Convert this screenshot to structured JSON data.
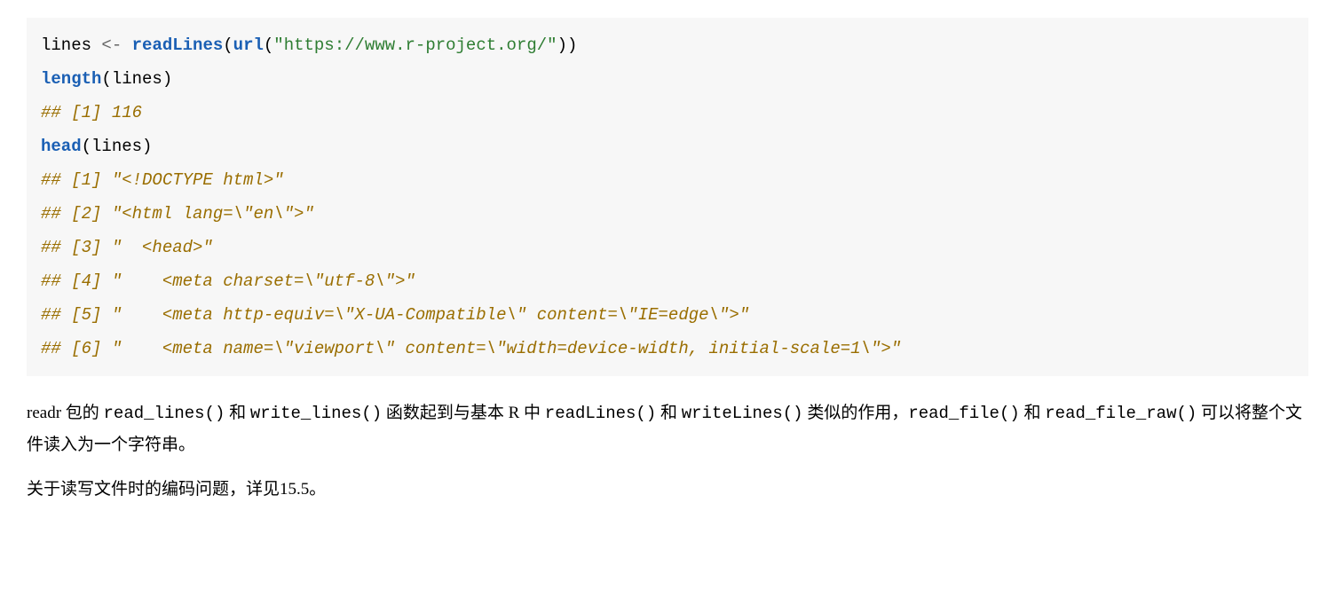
{
  "code_block": {
    "line1_var": "lines ",
    "line1_assign": "<- ",
    "line1_func1": "readLines",
    "line1_paren1": "(",
    "line1_func2": "url",
    "line1_paren2": "(",
    "line1_string": "\"https://www.r-project.org/\"",
    "line1_close": "))",
    "line2_func": "length",
    "line2_arg": "(lines)",
    "line3_comment": "## [1] 116",
    "line4_func": "head",
    "line4_arg": "(lines)",
    "line5_comment": "## [1] \"<!DOCTYPE html>\"",
    "line6_comment": "## [2] \"<html lang=\\\"en\\\">\"",
    "line7_comment": "## [3] \"  <head>\"",
    "line8_comment": "## [4] \"    <meta charset=\\\"utf-8\\\">\"",
    "line9_comment": "## [5] \"    <meta http-equiv=\\\"X-UA-Compatible\\\" content=\\\"IE=edge\\\">\"",
    "line10_comment": "## [6] \"    <meta name=\\\"viewport\\\" content=\\\"width=device-width, initial-scale=1\\\">\""
  },
  "para1": {
    "t1": "readr 包的 ",
    "c1": "read_lines()",
    "t2": " 和 ",
    "c2": "write_lines()",
    "t3": " 函数起到与基本 R 中 ",
    "c3": "readLines()",
    "t4": " 和 ",
    "c4": "writeLines()",
    "t5": " 类似的作用，",
    "c5": "read_file()",
    "t6": " 和 ",
    "c6": "read_file_raw()",
    "t7": " 可以将整个文件读入为一个字符串。"
  },
  "para2": {
    "t1": "关于读写文件时的编码问题，详见",
    "xref": "15.5",
    "t2": "。"
  }
}
